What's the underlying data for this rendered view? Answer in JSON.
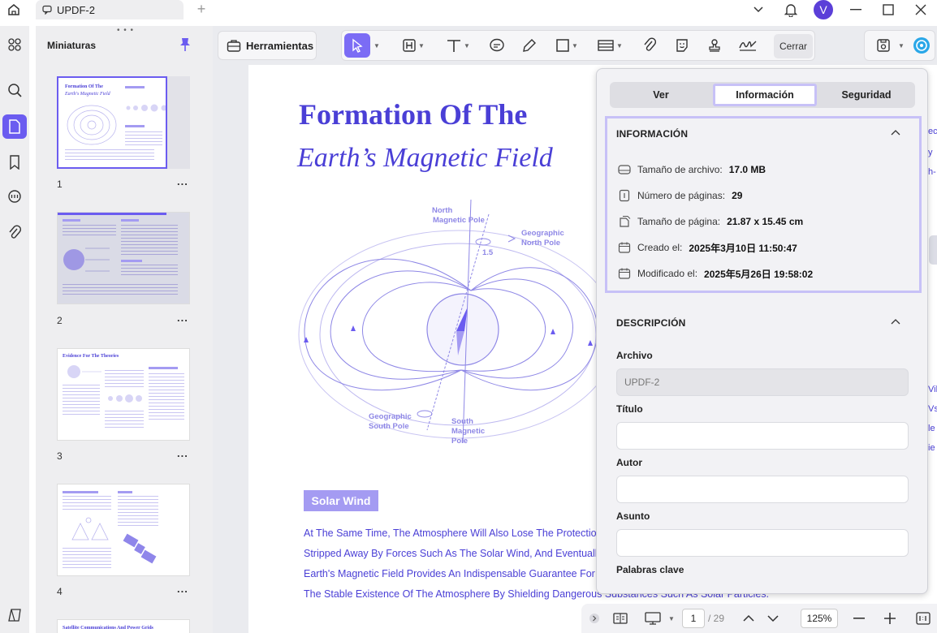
{
  "titlebar": {
    "tab_title": "UPDF-2",
    "avatar_letter": "V"
  },
  "thumbnails": {
    "title": "Miniaturas",
    "pages": [
      {
        "number": "1",
        "more": "...",
        "heading": "Formation Of The",
        "sub": "Earth's Magnetic Field"
      },
      {
        "number": "2",
        "more": "..."
      },
      {
        "number": "3",
        "more": "...",
        "heading": "Evidence For The Theories"
      },
      {
        "number": "4",
        "more": "..."
      },
      {
        "heading": "Satellite Communications And Power Grids"
      }
    ]
  },
  "toolbar": {
    "tools_label": "Herramientas",
    "close_label": "Cerrar"
  },
  "document": {
    "title_line1": "Formation Of The",
    "title_line2": "Earth’s Magnetic Field",
    "diagram_labels": {
      "north_magnetic": [
        "North",
        "Magnetic Pole"
      ],
      "geographic_north": [
        "Geographic",
        "North Pole"
      ],
      "angle": "1.5",
      "geographic_south": [
        "Geographic",
        "South Pole"
      ],
      "south_magnetic": [
        "South",
        "Magnetic",
        "Pole"
      ]
    },
    "section_badge": "Solar Wind",
    "body_lines": [
      "At The Same Time, The Atmosphere Will Also Lose The Protection Of",
      "Stripped Away By Forces Such As The Solar Wind, And Eventually Di",
      "Earth's Magnetic Field Provides An Indispensable Guarantee For The",
      "The Stable Existence Of The Atmosphere By Shielding Dangerous Substances Such As Solar Particles."
    ],
    "edge_glyphs": [
      "ec",
      "y",
      "h-",
      "Vill",
      "Vs",
      "le",
      "ie"
    ]
  },
  "statusbar": {
    "current_page": "1",
    "total_pages": "/ 29",
    "zoom": "125%"
  },
  "panel": {
    "tabs": [
      "Ver",
      "Información",
      "Seguridad"
    ],
    "active_tab": "Información",
    "info_title": "INFORMACIÓN",
    "info_rows": [
      {
        "icon": "drive-icon",
        "label": "Tamaño de archivo:",
        "value": "17.0 MB"
      },
      {
        "icon": "page-count-icon",
        "label": "Número de páginas:",
        "value": "29"
      },
      {
        "icon": "page-size-icon",
        "label": "Tamaño de página:",
        "value": "21.87 x 15.45 cm"
      },
      {
        "icon": "calendar-icon",
        "label": "Creado el:",
        "value": "2025年3月10日 11:50:47"
      },
      {
        "icon": "calendar-icon",
        "label": "Modificado el:",
        "value": "2025年5月26日 19:58:02"
      }
    ],
    "desc_title": "DESCRIPCIÓN",
    "fields": [
      {
        "label": "Archivo",
        "value": "UPDF-2",
        "filled": true
      },
      {
        "label": "Título",
        "value": ""
      },
      {
        "label": "Autor",
        "value": ""
      },
      {
        "label": "Asunto",
        "value": ""
      },
      {
        "label": "Palabras clave",
        "value": ""
      }
    ]
  },
  "colors": {
    "accent": "#6b5cf0",
    "doc_blue": "#4a3fd6",
    "highlight_border": "#c7c1f7"
  }
}
